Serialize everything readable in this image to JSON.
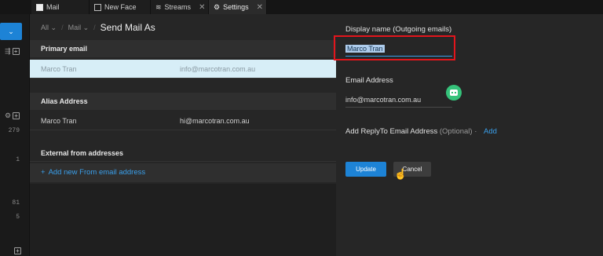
{
  "tabs": [
    {
      "label": "Mail",
      "icon": "checkbox-icon",
      "active": false
    },
    {
      "label": "New Face",
      "icon": "envelope-icon",
      "active": false
    },
    {
      "label": "Streams",
      "icon": "streams-icon",
      "active": false
    },
    {
      "label": "Settings",
      "icon": "gear-icon",
      "active": true
    }
  ],
  "rail": {
    "compose_icon": "chevron-down-icon",
    "numbers": [
      "279",
      "1",
      "81",
      "5"
    ]
  },
  "breadcrumb": {
    "all": "All",
    "mail": "Mail",
    "current": "Send Mail As"
  },
  "primary": {
    "header": "Primary email",
    "name": "Marco Tran",
    "email": "info@marcotran.com.au"
  },
  "alias": {
    "header": "Alias Address",
    "name": "Marco Tran",
    "email": "hi@marcotran.com.au"
  },
  "external": {
    "header": "External from addresses",
    "add_link": "Add new From email address"
  },
  "form": {
    "display_name_label": "Display name (Outgoing emails)",
    "display_name_value": "Marco Tran",
    "email_label": "Email Address",
    "email_value": "info@marcotran.com.au",
    "replyto_label": "Add ReplyTo Email Address",
    "replyto_optional": "(Optional)",
    "replyto_add": "Add",
    "update_label": "Update",
    "cancel_label": "Cancel"
  },
  "colors": {
    "accent": "#1d83d6",
    "highlight_box": "#e3151c",
    "selected_row": "#d7eef7"
  }
}
